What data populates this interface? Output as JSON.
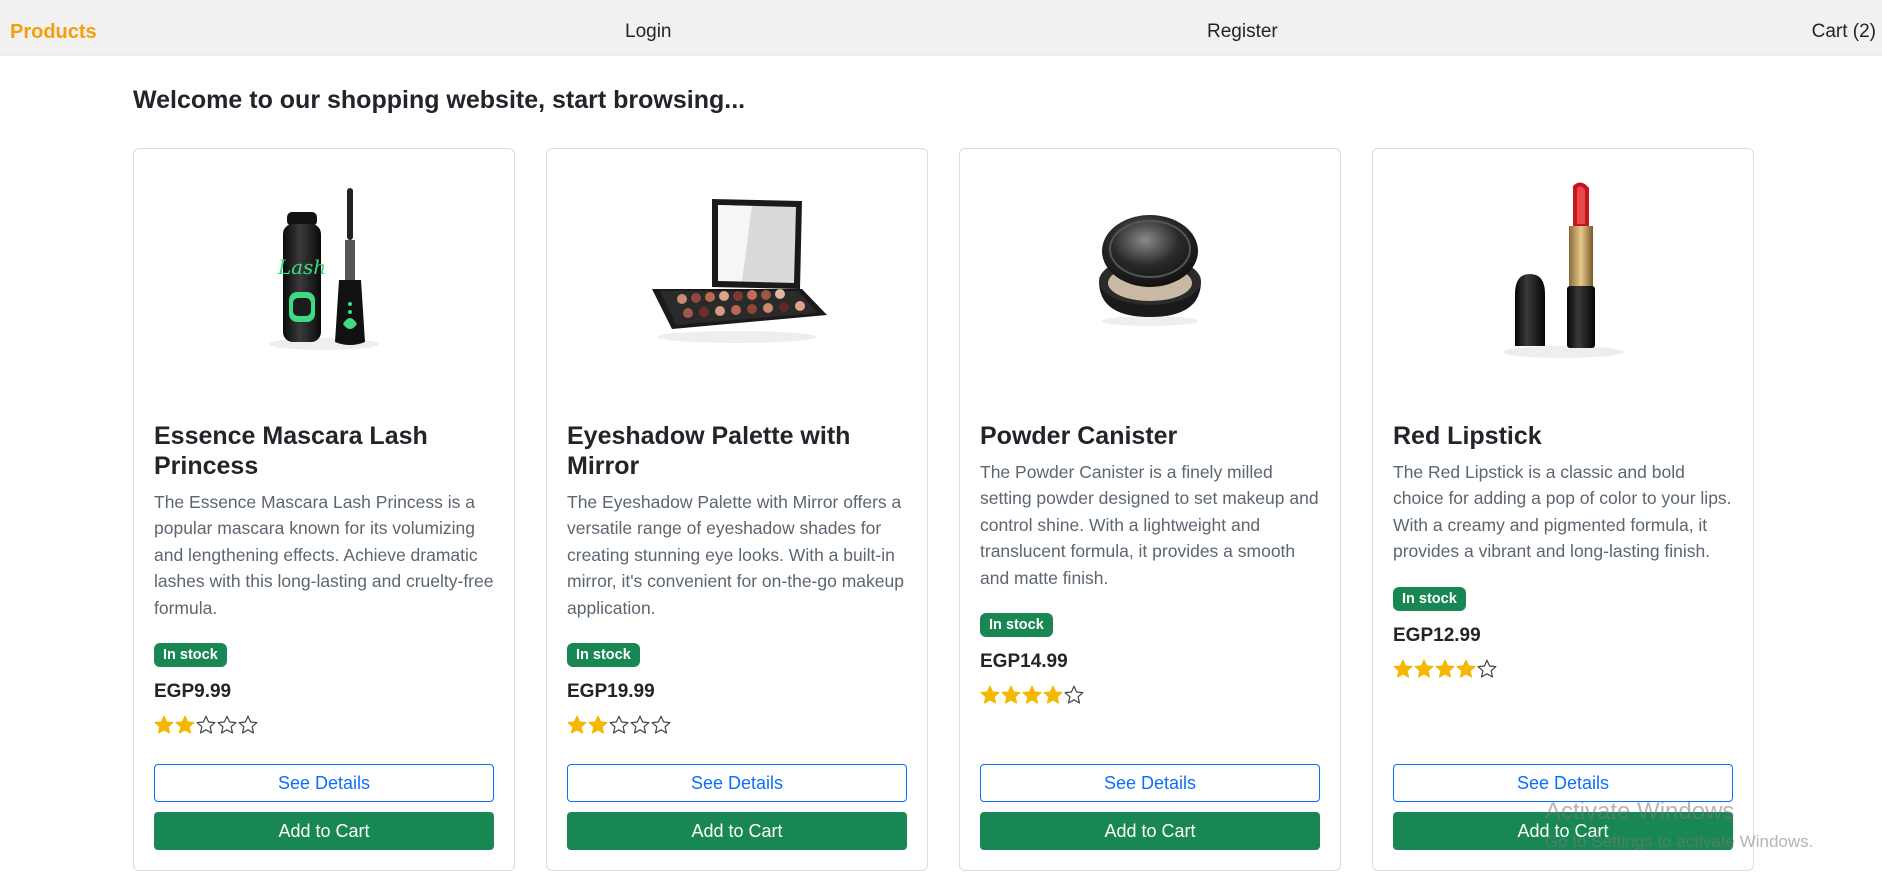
{
  "nav": {
    "brand": "Products",
    "login": "Login",
    "register": "Register",
    "cart": "Cart (2)"
  },
  "welcome": "Welcome to our shopping website, start browsing...",
  "products": [
    {
      "title": "Essence Mascara Lash Princess",
      "description": "The Essence Mascara Lash Princess is a popular mascara known for its volumizing and lengthening effects. Achieve dramatic lashes with this long-lasting and cruelty-free formula.",
      "stock": "In stock",
      "price": "EGP9.99",
      "rating": 2,
      "see_details": "See Details",
      "add_to_cart": "Add to Cart",
      "image": "mascara-image"
    },
    {
      "title": "Eyeshadow Palette with Mirror",
      "description": "The Eyeshadow Palette with Mirror offers a versatile range of eyeshadow shades for creating stunning eye looks. With a built-in mirror, it's convenient for on-the-go makeup application.",
      "stock": "In stock",
      "price": "EGP19.99",
      "rating": 2,
      "see_details": "See Details",
      "add_to_cart": "Add to Cart",
      "image": "eyeshadow-palette-image"
    },
    {
      "title": "Powder Canister",
      "description": "The Powder Canister is a finely milled setting powder designed to set makeup and control shine. With a lightweight and translucent formula, it provides a smooth and matte finish.",
      "stock": "In stock",
      "price": "EGP14.99",
      "rating": 4,
      "see_details": "See Details",
      "add_to_cart": "Add to Cart",
      "image": "powder-canister-image"
    },
    {
      "title": "Red Lipstick",
      "description": "The Red Lipstick is a classic and bold choice for adding a pop of color to your lips. With a creamy and pigmented formula, it provides a vibrant and long-lasting finish.",
      "stock": "In stock",
      "price": "EGP12.99",
      "rating": 4,
      "see_details": "See Details",
      "add_to_cart": "Add to Cart",
      "image": "lipstick-image"
    }
  ],
  "watermark": {
    "title": "Activate Windows",
    "subtitle": "Go to Settings to activate Windows."
  },
  "colors": {
    "brand": "#f59e0b",
    "success": "#198754",
    "primary": "#0d6efd",
    "star": "#f5b800"
  }
}
